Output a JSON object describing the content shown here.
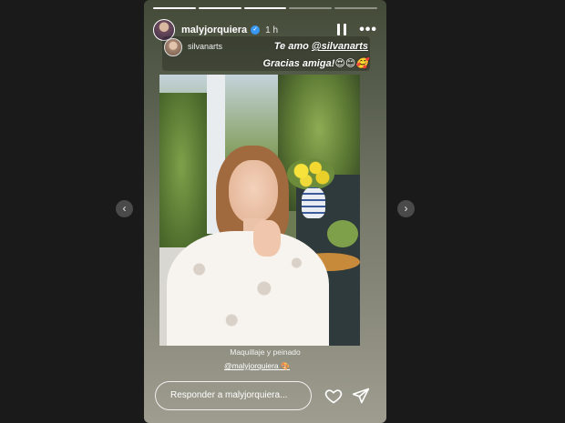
{
  "story": {
    "progress_segments": 5,
    "progress_done": 3,
    "username": "malyjorquiera",
    "timestamp": "1 h",
    "more_label": "•••",
    "mention": {
      "name": "silvanarts",
      "line1_prefix": "Te amo ",
      "line1_tag": "@silvanarts",
      "line2": "Gracias amiga!😍😊🥰"
    },
    "credits": {
      "line1": "Maquillaje y peinado",
      "line2": "@malyjorquiera",
      "line2_emoji": "🎨"
    },
    "reply_placeholder": "Responder a malyjorquiera..."
  },
  "icons": {
    "prev": "chevron-left",
    "next": "chevron-right",
    "pause": "pause",
    "heart": "heart",
    "send": "paper-plane"
  },
  "colors": {
    "page_bg": "#1a1a1a",
    "verified": "#3897f0"
  }
}
